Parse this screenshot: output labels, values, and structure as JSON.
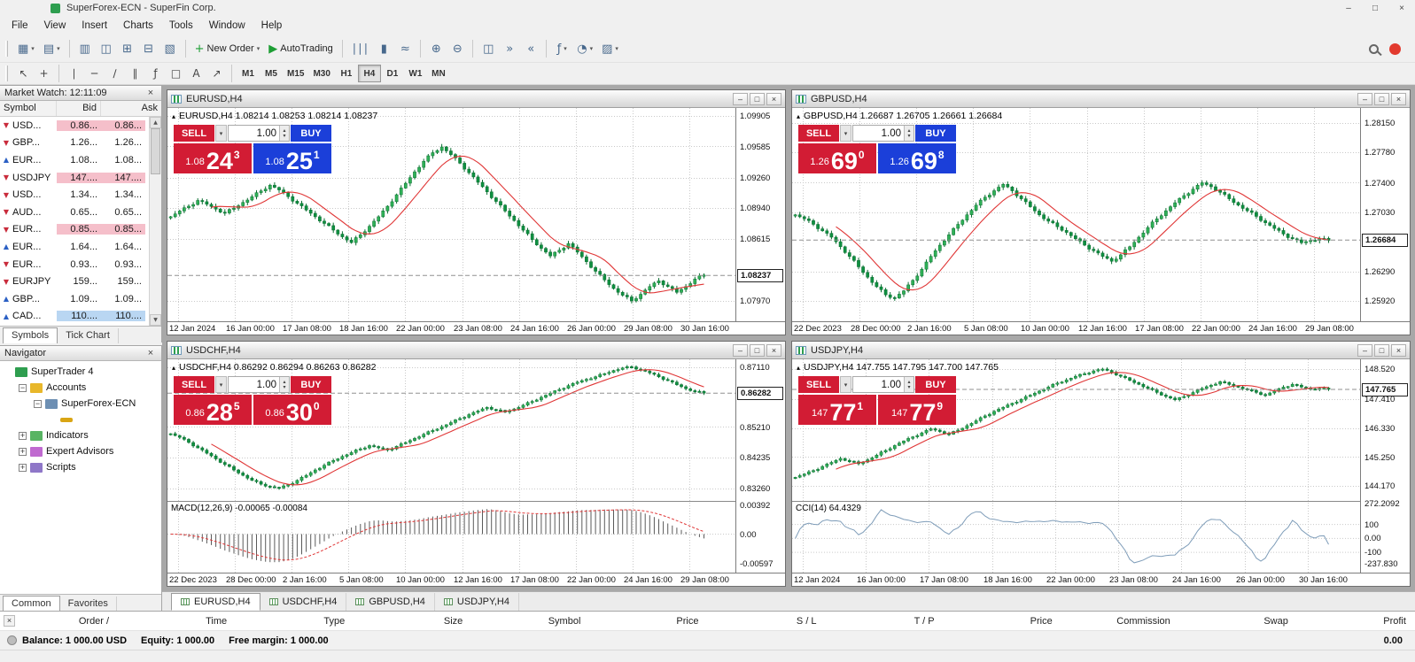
{
  "window": {
    "title": "SuperForex-ECN - SuperFin Corp."
  },
  "icons": {
    "minimize": "–",
    "maximize": "□",
    "close": "×",
    "caret_down": "▾",
    "tick_up": "▲",
    "tick_down": "▼",
    "spin_up": "▴",
    "spin_down": "▾",
    "collapse": "▴"
  },
  "menu": {
    "items": [
      "File",
      "View",
      "Insert",
      "Charts",
      "Tools",
      "Window",
      "Help"
    ]
  },
  "toolbar": {
    "groups": [
      [
        {
          "name": "new-chart",
          "glyph": "▦",
          "caret": true
        },
        {
          "name": "profiles",
          "glyph": "▤",
          "caret": true
        }
      ],
      [
        {
          "name": "market-watch",
          "glyph": "▥"
        },
        {
          "name": "data-window",
          "glyph": "◫"
        },
        {
          "name": "navigator",
          "glyph": "⊞"
        },
        {
          "name": "terminal-toggle",
          "glyph": "⊟"
        },
        {
          "name": "strategy-tester",
          "glyph": "▧"
        }
      ],
      [
        {
          "name": "new-order",
          "glyph": "+",
          "glyph_color": "#1d9e34",
          "label": "New Order",
          "caret": true
        },
        {
          "name": "autotrading",
          "glyph": "▶",
          "glyph_color": "#1d9e34",
          "label": "AutoTrading"
        }
      ],
      [
        {
          "name": "bar-chart",
          "glyph": "∣∣∣"
        },
        {
          "name": "candlestick-chart",
          "glyph": "▮"
        },
        {
          "name": "line-chart",
          "glyph": "≈"
        }
      ],
      [
        {
          "name": "zoom-in",
          "glyph": "⊕"
        },
        {
          "name": "zoom-out",
          "glyph": "⊖"
        }
      ],
      [
        {
          "name": "tile-windows",
          "glyph": "◫"
        },
        {
          "name": "auto-scroll",
          "glyph": "»"
        },
        {
          "name": "chart-shift",
          "glyph": "«"
        }
      ],
      [
        {
          "name": "indicators",
          "glyph": "ƒ",
          "caret": true
        },
        {
          "name": "periods",
          "glyph": "◔",
          "caret": true
        },
        {
          "name": "templates",
          "glyph": "▨",
          "caret": true
        }
      ]
    ]
  },
  "tools": {
    "groups": [
      [
        {
          "name": "cursor-tool",
          "glyph": "↖"
        },
        {
          "name": "crosshair-tool",
          "glyph": "+"
        }
      ],
      [
        {
          "name": "vertical-line-tool",
          "glyph": "∣"
        },
        {
          "name": "horizontal-line-tool",
          "glyph": "─"
        },
        {
          "name": "trendline-tool",
          "glyph": "∕"
        },
        {
          "name": "channel-tool",
          "glyph": "∥"
        },
        {
          "name": "fibonacci-tool",
          "glyph": "ƒ"
        },
        {
          "name": "shapes-tool",
          "glyph": "□"
        },
        {
          "name": "text-tool",
          "glyph": "A"
        },
        {
          "name": "arrows-tool",
          "glyph": "↗"
        }
      ]
    ]
  },
  "timeframes": {
    "items": [
      "M1",
      "M5",
      "M15",
      "M30",
      "H1",
      "H4",
      "D1",
      "W1",
      "MN"
    ],
    "active": "H4"
  },
  "market_watch": {
    "title": "Market Watch: 12:11:09",
    "columns": [
      "Symbol",
      "Bid",
      "Ask"
    ],
    "rows": [
      {
        "symbol": "USD...",
        "bid": "0.86...",
        "ask": "0.86...",
        "dir": "down",
        "hl": "pink"
      },
      {
        "symbol": "GBP...",
        "bid": "1.26...",
        "ask": "1.26...",
        "dir": "down",
        "hl": "none"
      },
      {
        "symbol": "EUR...",
        "bid": "1.08...",
        "ask": "1.08...",
        "dir": "up",
        "hl": "none"
      },
      {
        "symbol": "USDJPY",
        "bid": "147....",
        "ask": "147....",
        "dir": "down",
        "hl": "pink"
      },
      {
        "symbol": "USD...",
        "bid": "1.34...",
        "ask": "1.34...",
        "dir": "down",
        "hl": "none"
      },
      {
        "symbol": "AUD...",
        "bid": "0.65...",
        "ask": "0.65...",
        "dir": "down",
        "hl": "none"
      },
      {
        "symbol": "EUR...",
        "bid": "0.85...",
        "ask": "0.85...",
        "dir": "down",
        "hl": "pink"
      },
      {
        "symbol": "EUR...",
        "bid": "1.64...",
        "ask": "1.64...",
        "dir": "up",
        "hl": "none"
      },
      {
        "symbol": "EUR...",
        "bid": "0.93...",
        "ask": "0.93...",
        "dir": "down",
        "hl": "none"
      },
      {
        "symbol": "EURJPY",
        "bid": "159...",
        "ask": "159...",
        "dir": "down",
        "hl": "none"
      },
      {
        "symbol": "GBP...",
        "bid": "1.09...",
        "ask": "1.09...",
        "dir": "up",
        "hl": "none"
      },
      {
        "symbol": "CAD...",
        "bid": "110....",
        "ask": "110....",
        "dir": "up",
        "hl": "blue"
      }
    ],
    "tabs": [
      "Symbols",
      "Tick Chart"
    ],
    "active_tab": "Symbols"
  },
  "navigator": {
    "title": "Navigator",
    "tree": [
      {
        "label": "SuperTrader 4",
        "level": 0,
        "expander": "none",
        "icon": "terminal"
      },
      {
        "label": "Accounts",
        "level": 1,
        "expander": "minus",
        "icon": "accounts"
      },
      {
        "label": "SuperForex-ECN",
        "level": 2,
        "expander": "minus",
        "icon": "server"
      },
      {
        "label": "",
        "level": 3,
        "expander": "none",
        "icon": "key"
      },
      {
        "label": "Indicators",
        "level": 1,
        "expander": "plus",
        "icon": "indicator"
      },
      {
        "label": "Expert Advisors",
        "level": 1,
        "expander": "plus",
        "icon": "ea"
      },
      {
        "label": "Scripts",
        "level": 1,
        "expander": "plus",
        "icon": "script"
      }
    ],
    "tabs": [
      "Common",
      "Favorites"
    ],
    "active_tab": "Common"
  },
  "chart_windows": [
    {
      "title": "EURUSD,H4",
      "ohlc": "EURUSD,H4  1.08214 1.08253 1.08214 1.08237",
      "trade": {
        "sell_label": "SELL",
        "buy_label": "BUY",
        "lots": "1.00",
        "sell_prefix": "1.08",
        "sell_big": "24",
        "sell_sup": "3",
        "buy_prefix": "1.08",
        "buy_big": "25",
        "buy_sup": "1",
        "sell_color": "#d21c34",
        "buy_color": "#1b3fd9"
      }
    },
    {
      "title": "GBPUSD,H4",
      "ohlc": "GBPUSD,H4  1.26687 1.26705 1.26661 1.26684",
      "trade": {
        "sell_label": "SELL",
        "buy_label": "BUY",
        "lots": "1.00",
        "sell_prefix": "1.26",
        "sell_big": "69",
        "sell_sup": "0",
        "buy_prefix": "1.26",
        "buy_big": "69",
        "buy_sup": "8",
        "sell_color": "#d21c34",
        "buy_color": "#1b3fd9"
      }
    },
    {
      "title": "USDCHF,H4",
      "ohlc": "USDCHF,H4  0.86292 0.86294 0.86263 0.86282",
      "trade": {
        "sell_label": "SELL",
        "buy_label": "BUY",
        "lots": "1.00",
        "sell_prefix": "0.86",
        "sell_big": "28",
        "sell_sup": "5",
        "buy_prefix": "0.86",
        "buy_big": "30",
        "buy_sup": "0",
        "sell_color": "#d21c34",
        "buy_color": "#d21c34"
      }
    },
    {
      "title": "USDJPY,H4",
      "ohlc": "USDJPY,H4  147.755 147.795 147.700 147.765",
      "trade": {
        "sell_label": "SELL",
        "buy_label": "BUY",
        "lots": "1.00",
        "sell_prefix": "147",
        "sell_big": "77",
        "sell_sup": "1",
        "buy_prefix": "147",
        "buy_big": "77",
        "buy_sup": "9",
        "sell_color": "#d21c34",
        "buy_color": "#d21c34"
      }
    }
  ],
  "chart_data": [
    {
      "type": "candlestick",
      "title": "EURUSD,H4",
      "symbol": "EURUSD",
      "timeframe": "H4",
      "ohlc": {
        "open": "1.08214",
        "high": "1.08253",
        "low": "1.08214",
        "close": "1.08237"
      },
      "current_price": "1.08237",
      "y_range": [
        1.0785,
        1.0995
      ],
      "y_ticks": [
        "1.09905",
        "1.09585",
        "1.09260",
        "1.08940",
        "1.08615",
        "1.07970"
      ],
      "x_labels": [
        "12 Jan 2024",
        "16 Jan 00:00",
        "17 Jan 08:00",
        "18 Jan 16:00",
        "22 Jan 00:00",
        "23 Jan 08:00",
        "24 Jan 16:00",
        "26 Jan 00:00",
        "29 Jan 08:00",
        "30 Jan 16:00"
      ],
      "ma_color": "#e03636",
      "closes": [
        1.0885,
        1.0891,
        1.0896,
        1.0902,
        1.0898,
        1.0893,
        1.0889,
        1.0894,
        1.09,
        1.0906,
        1.0912,
        1.0918,
        1.0913,
        1.0906,
        1.0899,
        1.0892,
        1.0885,
        1.0878,
        1.0871,
        1.0864,
        1.0858,
        1.0866,
        1.0875,
        1.0885,
        1.0896,
        1.0908,
        1.092,
        1.0932,
        1.0943,
        1.0952,
        1.0958,
        1.095,
        1.0941,
        1.0931,
        1.0921,
        1.0911,
        1.0901,
        1.0891,
        1.0881,
        1.0871,
        1.0861,
        1.0852,
        1.0844,
        1.085,
        1.0857,
        1.0848,
        1.0838,
        1.0828,
        1.0819,
        1.081,
        1.0803,
        1.0797,
        1.0804,
        1.0812,
        1.0818,
        1.0812,
        1.0806,
        1.0812,
        1.082,
        1.0824
      ],
      "indicator": null
    },
    {
      "type": "candlestick",
      "title": "GBPUSD,H4",
      "symbol": "GBPUSD",
      "timeframe": "H4",
      "ohlc": {
        "open": "1.26687",
        "high": "1.26705",
        "low": "1.26661",
        "close": "1.26684"
      },
      "current_price": "1.26684",
      "y_range": [
        1.2578,
        1.2829
      ],
      "y_ticks": [
        "1.28150",
        "1.27780",
        "1.27400",
        "1.27030",
        "1.26290",
        "1.25920"
      ],
      "x_labels": [
        "22 Dec 2023",
        "28 Dec 00:00",
        "2 Jan 16:00",
        "5 Jan 08:00",
        "10 Jan 00:00",
        "12 Jan 16:00",
        "17 Jan 08:00",
        "22 Jan 00:00",
        "24 Jan 16:00",
        "29 Jan 08:00"
      ],
      "ma_color": "#e03636",
      "closes": [
        1.27,
        1.2695,
        1.2688,
        1.268,
        1.2672,
        1.266,
        1.2648,
        1.2635,
        1.2622,
        1.261,
        1.26,
        1.2596,
        1.2605,
        1.2618,
        1.2632,
        1.2648,
        1.2662,
        1.2675,
        1.2688,
        1.27,
        1.2712,
        1.2722,
        1.273,
        1.2738,
        1.273,
        1.272,
        1.271,
        1.27,
        1.2692,
        1.2685,
        1.2678,
        1.267,
        1.2662,
        1.2655,
        1.2648,
        1.2642,
        1.265,
        1.266,
        1.2672,
        1.2684,
        1.2695,
        1.2705,
        1.2715,
        1.2724,
        1.2732,
        1.274,
        1.2735,
        1.2728,
        1.272,
        1.2712,
        1.2705,
        1.2698,
        1.269,
        1.2683,
        1.2676,
        1.267,
        1.2665,
        1.2668,
        1.267,
        1.2668
      ],
      "indicator": null
    },
    {
      "type": "candlestick",
      "title": "USDCHF,H4",
      "symbol": "USDCHF",
      "timeframe": "H4",
      "ohlc": {
        "open": "0.86292",
        "high": "0.86294",
        "low": "0.86263",
        "close": "0.86282"
      },
      "current_price": "0.86282",
      "y_range": [
        0.8315,
        0.8724
      ],
      "y_ticks": [
        "0.87110",
        "0.85210",
        "0.84235",
        "0.83260"
      ],
      "x_labels": [
        "22 Dec 2023",
        "28 Dec 00:00",
        "2 Jan 16:00",
        "5 Jan 08:00",
        "10 Jan 00:00",
        "12 Jan 16:00",
        "17 Jan 08:00",
        "22 Jan 00:00",
        "24 Jan 16:00",
        "29 Jan 08:00"
      ],
      "ma_color": "#e03636",
      "closes": [
        0.85,
        0.8488,
        0.8472,
        0.8455,
        0.8438,
        0.842,
        0.8402,
        0.8385,
        0.8368,
        0.8352,
        0.834,
        0.8332,
        0.8328,
        0.8338,
        0.8352,
        0.8368,
        0.8385,
        0.84,
        0.8415,
        0.8428,
        0.844,
        0.8452,
        0.8462,
        0.8455,
        0.8448,
        0.846,
        0.8472,
        0.8485,
        0.8498,
        0.851,
        0.8522,
        0.8535,
        0.8548,
        0.856,
        0.8572,
        0.8583,
        0.8575,
        0.8568,
        0.8578,
        0.859,
        0.8602,
        0.8615,
        0.8628,
        0.864,
        0.8652,
        0.8663,
        0.8672,
        0.868,
        0.869,
        0.87,
        0.8708,
        0.8711,
        0.8702,
        0.8692,
        0.868,
        0.8668,
        0.8655,
        0.8642,
        0.8634,
        0.8628
      ],
      "indicator": {
        "type": "macd",
        "label": "MACD(12,26,9) -0.00065 -0.00084",
        "ticks": [
          "0.00392",
          "0.00",
          "-0.00597"
        ]
      }
    },
    {
      "type": "candlestick",
      "title": "USDJPY,H4",
      "symbol": "USDJPY",
      "timeframe": "H4",
      "ohlc": {
        "open": "147.755",
        "high": "147.795",
        "low": "147.700",
        "close": "147.765"
      },
      "current_price": "147.765",
      "y_range": [
        143.95,
        148.75
      ],
      "y_ticks": [
        "148.520",
        "147.410",
        "146.330",
        "145.250",
        "144.170"
      ],
      "x_labels": [
        "12 Jan 2024",
        "16 Jan 00:00",
        "17 Jan 08:00",
        "18 Jan 16:00",
        "22 Jan 00:00",
        "23 Jan 08:00",
        "24 Jan 16:00",
        "26 Jan 00:00",
        "30 Jan 16:00"
      ],
      "ma_color": "#e03636",
      "closes": [
        144.5,
        144.62,
        144.75,
        144.9,
        145.05,
        145.2,
        145.1,
        145.0,
        145.15,
        145.32,
        145.5,
        145.68,
        145.85,
        146.0,
        146.15,
        146.3,
        146.2,
        146.1,
        146.25,
        146.42,
        146.6,
        146.78,
        146.95,
        147.1,
        147.25,
        147.4,
        147.55,
        147.7,
        147.85,
        148.0,
        148.12,
        148.25,
        148.35,
        148.45,
        148.52,
        148.4,
        148.25,
        148.1,
        147.95,
        147.8,
        147.65,
        147.5,
        147.38,
        147.5,
        147.65,
        147.8,
        147.92,
        148.05,
        147.95,
        147.85,
        147.75,
        147.65,
        147.55,
        147.7,
        147.85,
        147.95,
        147.85,
        147.78,
        147.8,
        147.77
      ],
      "indicator": {
        "type": "cci",
        "label": "CCI(14) 64.4329",
        "ticks": [
          "272.2092",
          "100",
          "0.00",
          "-100",
          "-237.830"
        ]
      }
    }
  ],
  "chart_tabs": {
    "items": [
      "EURUSD,H4",
      "USDCHF,H4",
      "GBPUSD,H4",
      "USDJPY,H4"
    ],
    "active": "EURUSD,H4"
  },
  "terminal": {
    "columns": [
      "Order /",
      "Time",
      "Type",
      "Size",
      "Symbol",
      "Price",
      "S / L",
      "T / P",
      "Price",
      "Commission",
      "Swap",
      "Profit"
    ],
    "balance": "Balance: 1 000.00 USD",
    "equity": "Equity: 1 000.00",
    "free_margin": "Free margin: 1 000.00",
    "profit": "0.00"
  }
}
